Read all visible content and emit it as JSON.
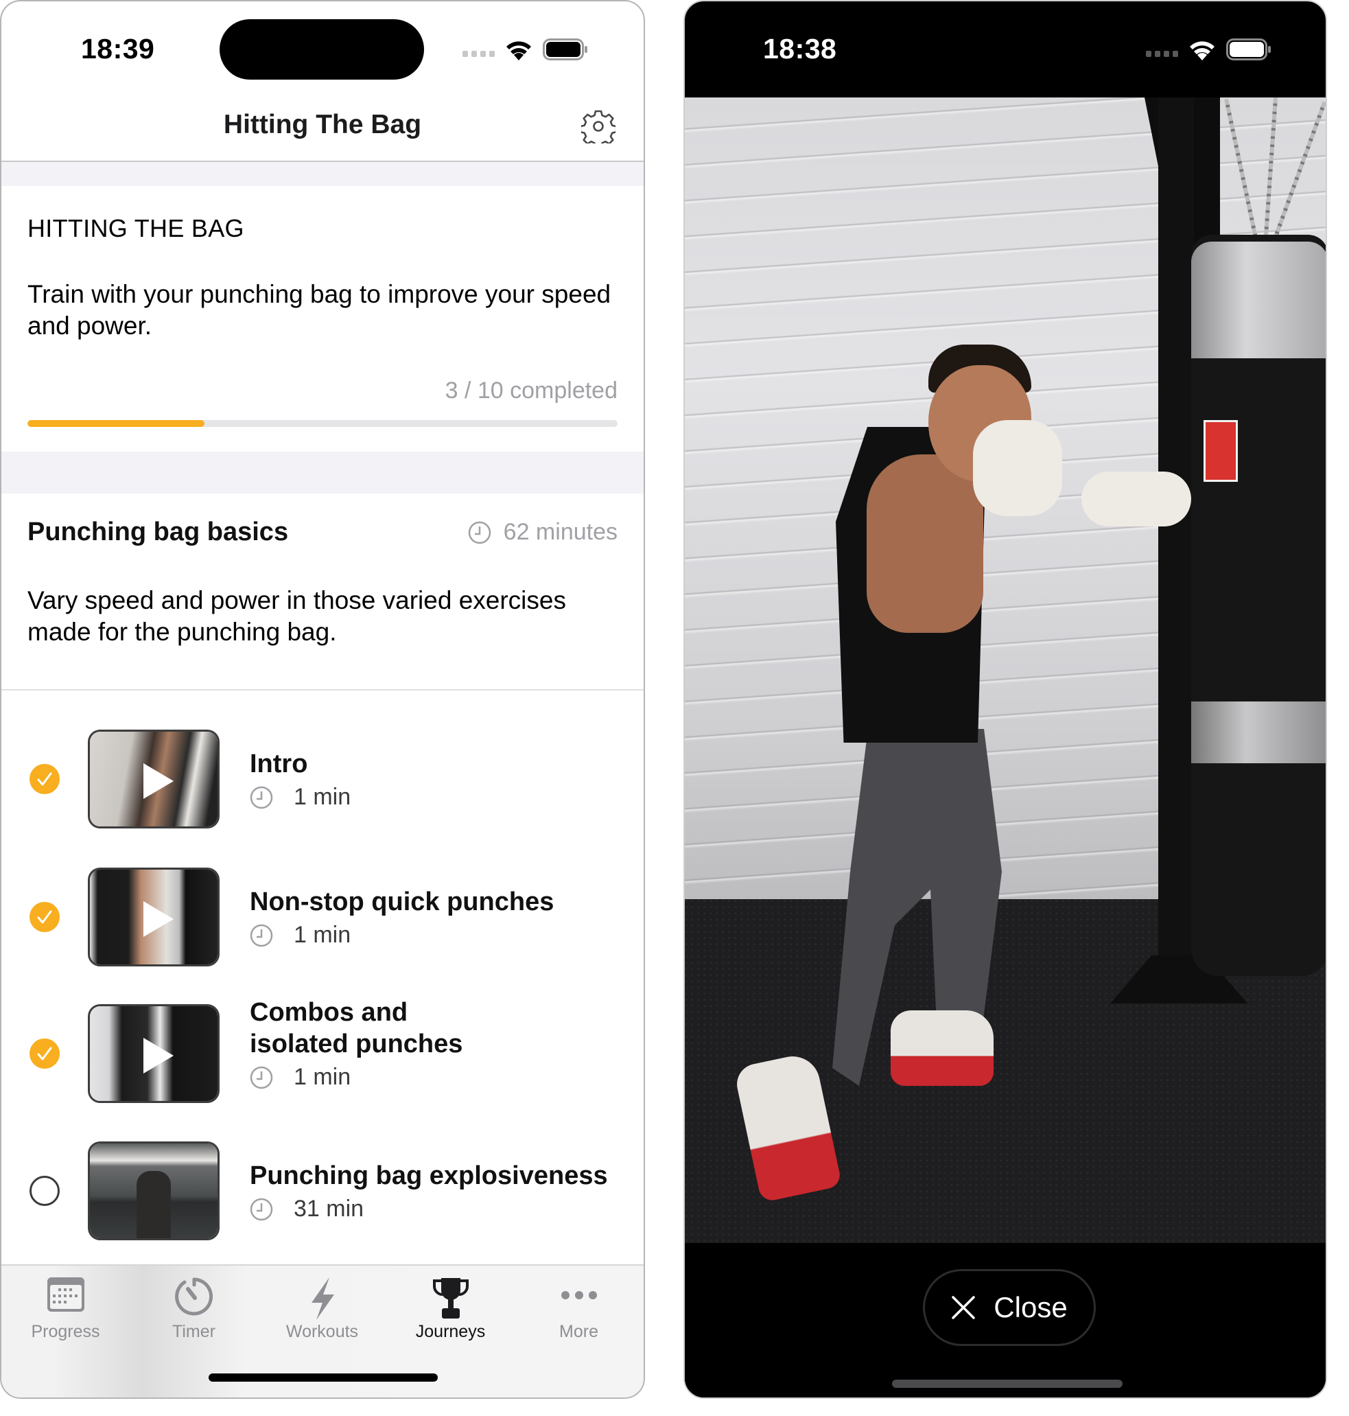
{
  "left_screen": {
    "status_bar": {
      "time": "18:39"
    },
    "nav": {
      "title": "Hitting The Bag",
      "settings_icon": "gear-icon"
    },
    "journey_card": {
      "heading": "HITTING THE BAG",
      "description": "Train with your punching bag to improve your speed and power.",
      "completed_label": "3 / 10 completed",
      "completed": 3,
      "total": 10,
      "progress_fraction": 0.3,
      "accent_color": "#F8AE1F"
    },
    "section": {
      "title": "Punching bag basics",
      "duration": "62 minutes",
      "description": "Vary speed and power in those varied exercises made for the punching bag."
    },
    "exercises": [
      {
        "title": "Intro",
        "duration": "1 min",
        "completed": true,
        "has_play": true
      },
      {
        "title": "Non-stop quick punches",
        "duration": "1 min",
        "completed": true,
        "has_play": true
      },
      {
        "title": "Combos and isolated punches",
        "duration": "1 min",
        "completed": true,
        "has_play": true
      },
      {
        "title": "Punching bag explosiveness",
        "duration": "31 min",
        "completed": false,
        "has_play": false
      }
    ],
    "tabbar": {
      "tabs": [
        {
          "label": "Progress",
          "icon": "calendar-icon",
          "active": false
        },
        {
          "label": "Timer",
          "icon": "timer-icon",
          "active": false
        },
        {
          "label": "Workouts",
          "icon": "bolt-icon",
          "active": false
        },
        {
          "label": "Journeys",
          "icon": "trophy-icon",
          "active": true
        },
        {
          "label": "More",
          "icon": "more-icon",
          "active": false
        }
      ]
    }
  },
  "right_screen": {
    "status_bar": {
      "time": "18:38"
    },
    "video": {
      "description": "Boxer punching a hanging bag"
    },
    "close_button": {
      "label": "Close",
      "icon": "close-icon"
    }
  }
}
